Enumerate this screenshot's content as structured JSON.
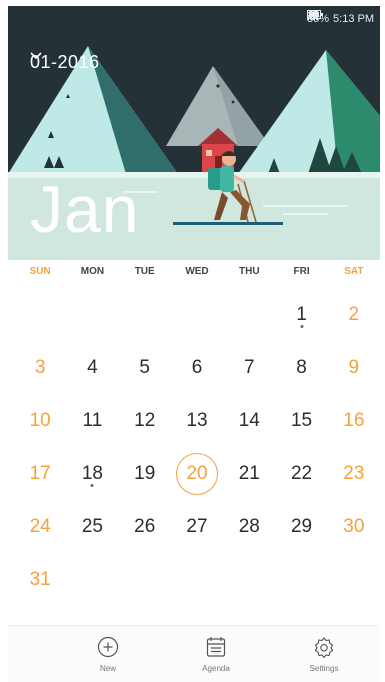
{
  "status_bar": {
    "battery": "85%",
    "time": "5:13 PM"
  },
  "header": {
    "month_year": "01-2016",
    "month_name": "Jan"
  },
  "weekdays": [
    "SUN",
    "MON",
    "TUE",
    "WED",
    "THU",
    "FRI",
    "SAT"
  ],
  "calendar": {
    "leading_blanks": 5,
    "today": "20",
    "event_days": [
      "1",
      "18"
    ],
    "days": [
      "1",
      "2",
      "3",
      "4",
      "5",
      "6",
      "7",
      "8",
      "9",
      "10",
      "11",
      "12",
      "13",
      "14",
      "15",
      "16",
      "17",
      "18",
      "19",
      "20",
      "21",
      "22",
      "23",
      "24",
      "25",
      "26",
      "27",
      "28",
      "29",
      "30",
      "31"
    ]
  },
  "bottom_bar": {
    "new_label": "New",
    "agenda_label": "Agenda",
    "settings_label": "Settings"
  },
  "colors": {
    "accent": "#f5a23b",
    "header_bg": "#243238",
    "ground": "#cfe7dd"
  }
}
